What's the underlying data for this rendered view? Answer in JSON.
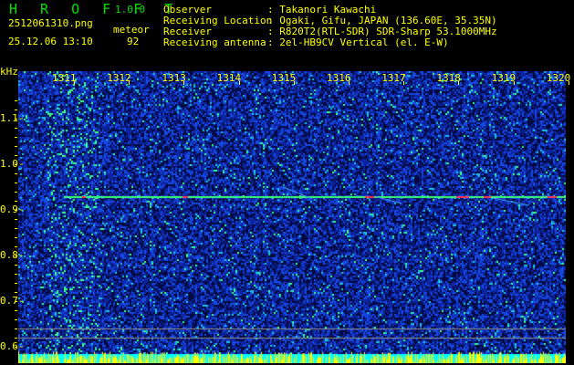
{
  "app": {
    "name": "H R O F F T",
    "version": "1.0.0"
  },
  "file": {
    "name": "2512061310.png",
    "datetime": "25.12.06 13:10"
  },
  "count": {
    "label": "meteor",
    "value": "92"
  },
  "info": [
    {
      "label": "Observer",
      "value": ": Takanori Kawachi"
    },
    {
      "label": "Receiving Location",
      "value": ": Ogaki, Gifu, JAPAN (136.60E, 35.35N)"
    },
    {
      "label": "Receiver",
      "value": ": R820T2(RTL-SDR) SDR-Sharp 53.1000MHz"
    },
    {
      "label": "Receiving antenna",
      "value": ": 2el-HB9CV Vertical (el. E-W)"
    }
  ],
  "chart_data": {
    "type": "heatmap",
    "ylabel": "kHz",
    "x_ticks": [
      "1311",
      "1312",
      "1313",
      "1314",
      "1315",
      "1316",
      "1317",
      "1318",
      "1319",
      "1320"
    ],
    "y_ticks": [
      "1.1",
      "1.0",
      "0.9",
      "0.8",
      "0.7",
      "0.6"
    ],
    "ylim": [
      0.58,
      1.2
    ],
    "carrier_khz": 0.93,
    "reference_lines_khz": [
      0.62,
      0.6
    ],
    "colors": {
      "background": "#000000",
      "labels": "#ffff00",
      "title": "#00e000",
      "noise": "#1030c0",
      "carrier": "#40ff80",
      "level_bar": "#ffff00",
      "level_base": "#00ffff"
    }
  }
}
